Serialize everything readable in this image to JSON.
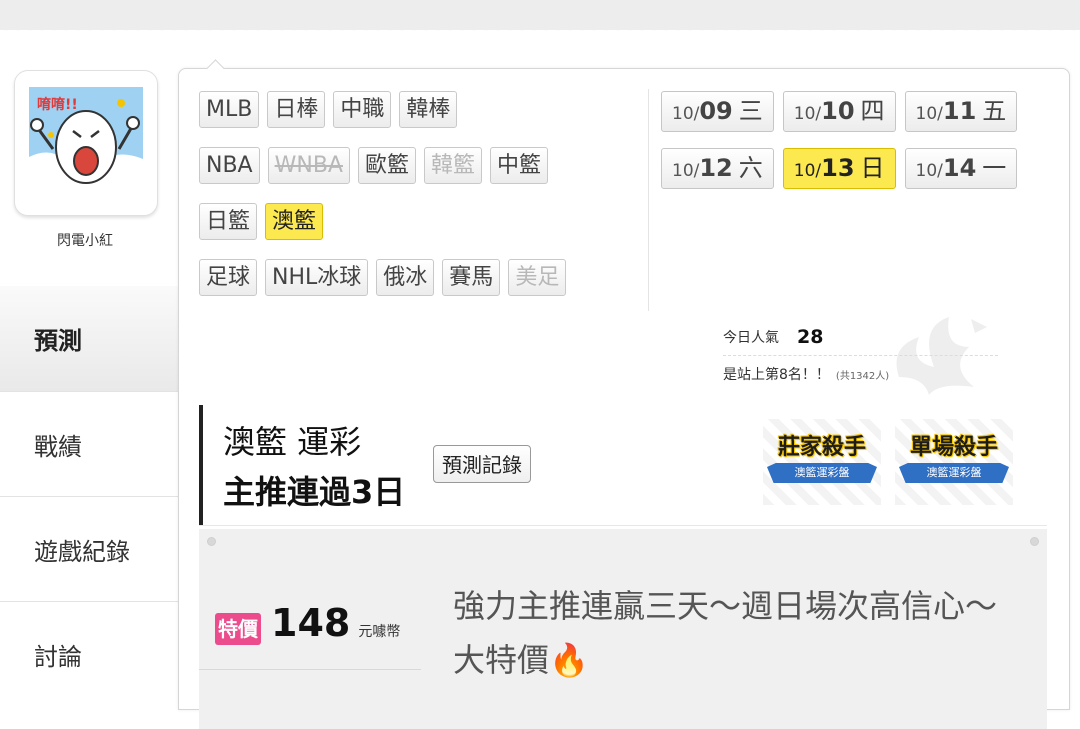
{
  "user": {
    "name": "閃電小紅"
  },
  "nav": {
    "items": [
      {
        "label": "預測",
        "active": true
      },
      {
        "label": "戰績",
        "active": false
      },
      {
        "label": "遊戲紀錄",
        "active": false
      },
      {
        "label": "討論",
        "active": false
      }
    ]
  },
  "tags": {
    "row1": [
      "MLB",
      "日棒",
      "中職",
      "韓棒"
    ],
    "row2": [
      "NBA",
      "WNBA",
      "歐籃",
      "韓籃",
      "中籃"
    ],
    "row3": [
      "日籃",
      "澳籃"
    ],
    "row4": [
      "足球",
      "NHL冰球",
      "俄冰",
      "賽馬",
      "美足"
    ],
    "active": "澳籃",
    "disabled": [
      "WNBA",
      "韓籃",
      "美足"
    ]
  },
  "dates": {
    "row1": [
      {
        "m": "10/",
        "d": "09",
        "w": "三"
      },
      {
        "m": "10/",
        "d": "10",
        "w": "四"
      },
      {
        "m": "10/",
        "d": "11",
        "w": "五"
      }
    ],
    "row2": [
      {
        "m": "10/",
        "d": "12",
        "w": "六"
      },
      {
        "m": "10/",
        "d": "13",
        "w": "日"
      },
      {
        "m": "10/",
        "d": "14",
        "w": "一"
      }
    ],
    "active": "13"
  },
  "popularity": {
    "label": "今日人氣",
    "count": "28",
    "rank_text": "是站上第8名！！",
    "total_text": "(共1342人)"
  },
  "banner": {
    "title_line1": "澳籃 運彩",
    "title_line2": "主推連過3日",
    "record_button": "預測記錄",
    "badges": [
      {
        "title": "莊家殺手",
        "ribbon": "澳籃運彩盤"
      },
      {
        "title": "單場殺手",
        "ribbon": "澳籃運彩盤"
      }
    ]
  },
  "offer": {
    "sale_badge": "特價",
    "price": "148",
    "unit": "元噱幣",
    "description": "強力主推連贏三天～週日場次高信心～大特價🔥"
  }
}
